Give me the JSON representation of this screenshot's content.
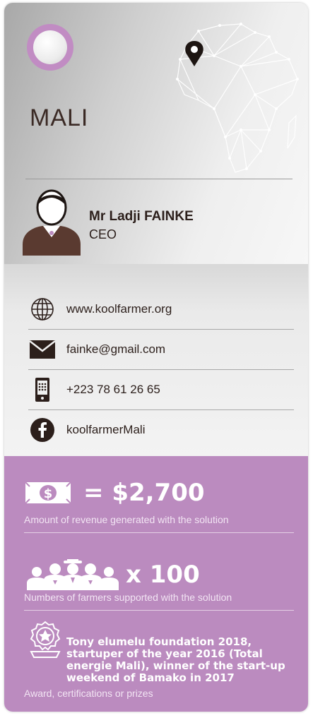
{
  "header": {
    "country": "MALI",
    "icons": {
      "badge": "circle-badge",
      "map": "africa-network-map",
      "pin": "map-pin-icon"
    }
  },
  "person": {
    "name": "Mr Ladji FAINKE",
    "role": "CEO"
  },
  "contacts": [
    {
      "icon": "globe-icon",
      "text": "www.koolfarmer.org"
    },
    {
      "icon": "envelope-icon",
      "text": "fainke@gmail.com"
    },
    {
      "icon": "phone-icon",
      "text": "+223 78 61 26 65"
    },
    {
      "icon": "facebook-icon",
      "text": "koolfarmerMali"
    }
  ],
  "stats": {
    "revenue": {
      "value": "= $2,700",
      "caption": "Amount of revenue generated with the solution"
    },
    "farmers": {
      "value": "x 100",
      "caption": "Numbers of farmers supported with the solution"
    },
    "award": {
      "text": "Tony elumelu foundation 2018, startuper of the year 2016 (Total energie Mali), winner of the  start-up weekend of Bamako in 2017",
      "caption": "Award, certifications or prizes"
    }
  },
  "colors": {
    "purple": "#bb8bbf",
    "dark_brown": "#3b2a25",
    "grey": "#cfcfcf"
  }
}
